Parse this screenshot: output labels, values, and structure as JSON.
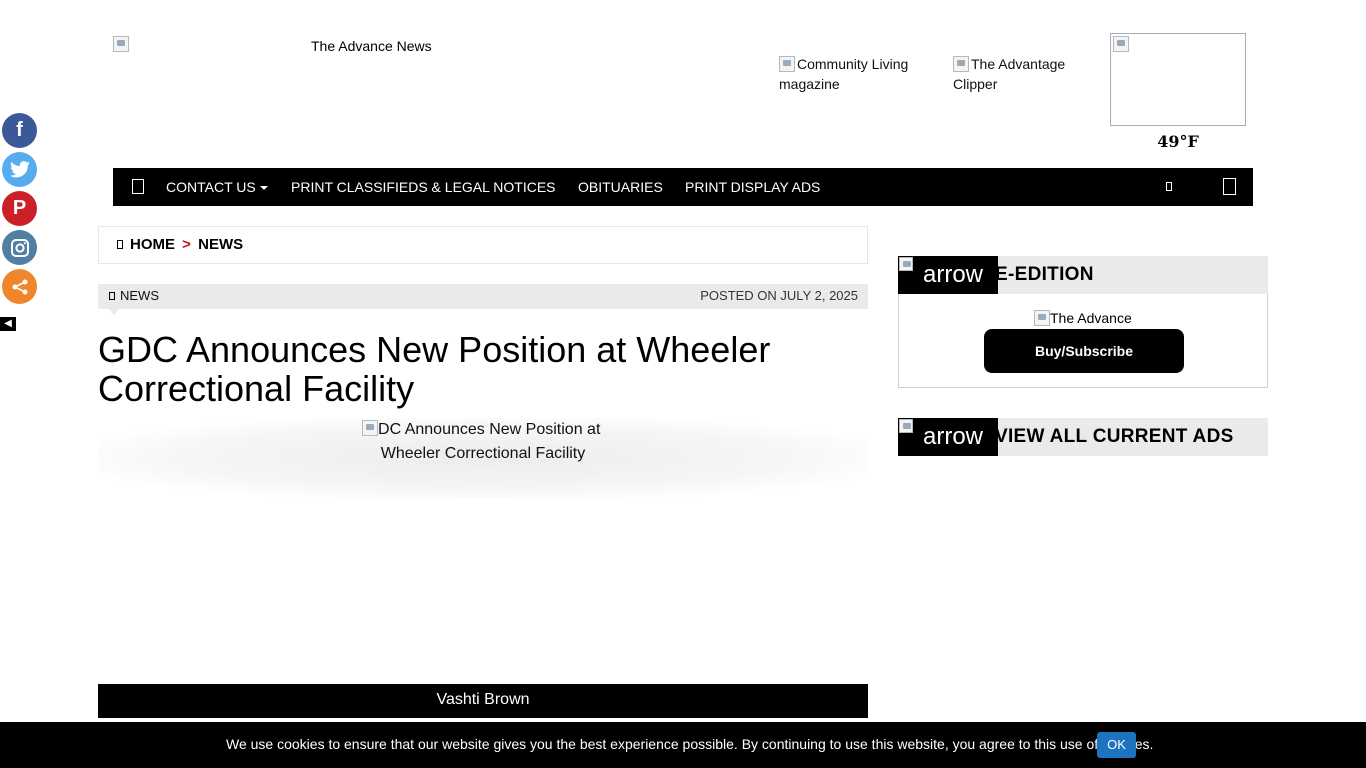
{
  "header": {
    "logo_alt": "The Advance News",
    "partners": [
      {
        "alt_line1": "Community Living",
        "alt_line2": "magazine"
      },
      {
        "alt_line1": "The Advantage",
        "alt_line2": "Clipper"
      }
    ],
    "weather_temp": "49°F"
  },
  "nav": {
    "items": [
      "CONTACT US",
      "PRINT CLASSIFIEDS & LEGAL NOTICES",
      "OBITUARIES",
      "PRINT DISPLAY ADS"
    ]
  },
  "social": [
    {
      "name": "facebook",
      "color": "#3b5998",
      "glyph": "f"
    },
    {
      "name": "twitter",
      "color": "#55acee",
      "glyph": "t"
    },
    {
      "name": "pinterest",
      "color": "#cb2027",
      "glyph": "P"
    },
    {
      "name": "instagram",
      "color": "#517fa4",
      "glyph": "◎"
    },
    {
      "name": "more",
      "color": "#f0862b",
      "glyph": "<"
    }
  ],
  "breadcrumb": {
    "home": "HOME",
    "separator": ">",
    "current": "NEWS"
  },
  "article": {
    "category": "NEWS",
    "posted": "POSTED ON JULY 2, 2025",
    "title": "GDC Announces New Position at Wheeler Correctional Facility",
    "image_alt": "GDC Announces New Position at Wheeler Correctional Facility",
    "author": "Vashti Brown"
  },
  "sidebar": {
    "arrow_alt": "arrow",
    "eedition_title": "E-EDITION",
    "eedition_image_alt": "The Advance",
    "buy_button": "Buy/Subscribe",
    "ads_title": "VIEW ALL CURRENT ADS"
  },
  "cookie": {
    "message": "We use cookies to ensure that our website gives you the best experience possible. By continuing to use this website, you agree to this use of cookies.",
    "ok_label": "OK"
  }
}
